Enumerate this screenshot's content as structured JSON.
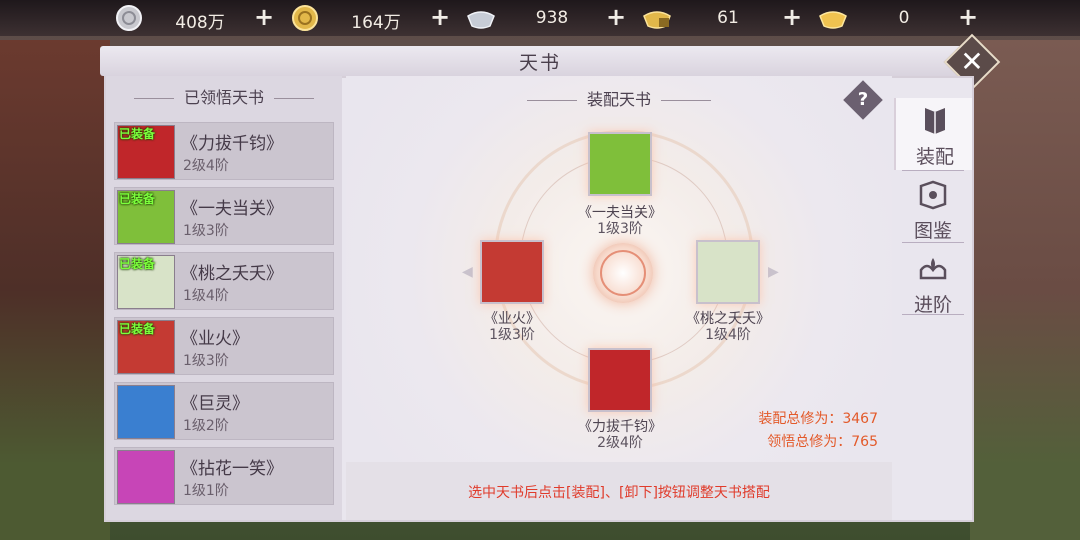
{
  "currencies": [
    {
      "icon": "silver-coin-icon",
      "amount": "408万"
    },
    {
      "icon": "gold-coin-icon",
      "amount": "164万"
    },
    {
      "icon": "silver-ingot-icon",
      "amount": "938"
    },
    {
      "icon": "locked-gold-ingot-icon",
      "amount": "61"
    },
    {
      "icon": "gold-ingot-icon",
      "amount": "0"
    }
  ],
  "plus_label": "+",
  "title": "天书",
  "close_label": "✕",
  "left": {
    "header": "已领悟天书",
    "items": [
      {
        "name": "《力拔千钧》",
        "level": "2级4阶",
        "equipped": "已装备",
        "color": "#c0262a"
      },
      {
        "name": "《一夫当关》",
        "level": "1级3阶",
        "equipped": "已装备",
        "color": "#7fbf3a"
      },
      {
        "name": "《桃之夭夭》",
        "level": "1级4阶",
        "equipped": "已装备",
        "color": "#d8e3c8"
      },
      {
        "name": "《业火》",
        "level": "1级3阶",
        "equipped": "已装备",
        "color": "#c43a33"
      },
      {
        "name": "《巨灵》",
        "level": "1级2阶",
        "equipped": "",
        "color": "#3a7fd0"
      },
      {
        "name": "《拈花一笑》",
        "level": "1级1阶",
        "equipped": "",
        "color": "#c745b7"
      }
    ]
  },
  "center": {
    "header": "装配天书",
    "help_label": "?",
    "slots": {
      "top": {
        "name": "《一夫当关》",
        "level": "1级3阶",
        "color": "#7fbf3a"
      },
      "left": {
        "name": "《业火》",
        "level": "1级3阶",
        "color": "#c43a33"
      },
      "right": {
        "name": "《桃之夭夭》",
        "level": "1级4阶",
        "color": "#d8e3c8"
      },
      "bottom": {
        "name": "《力拔千钧》",
        "level": "2级4阶",
        "color": "#c0262a"
      }
    },
    "total_equipped": "装配总修为：3467",
    "total_learned": "领悟总修为：765",
    "hint": "选中天书后点击[装配]、[卸下]按钮调整天书搭配"
  },
  "tabs": [
    {
      "label": "装配",
      "icon": "book-icon",
      "active": true
    },
    {
      "label": "图鉴",
      "icon": "atlas-icon",
      "active": false
    },
    {
      "label": "进阶",
      "icon": "lotus-book-icon",
      "active": false
    }
  ]
}
